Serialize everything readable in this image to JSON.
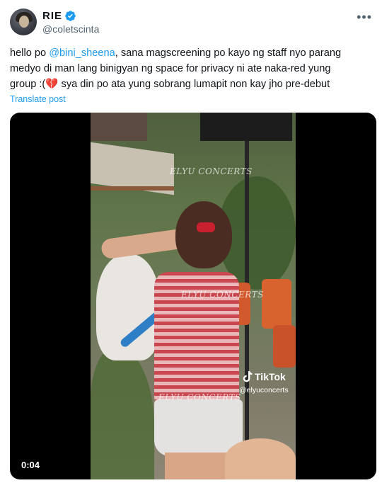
{
  "author": {
    "display_name": "RIE",
    "handle": "@coletscinta",
    "verified": true,
    "verified_color": "#1d9bf0"
  },
  "menu": {
    "more_icon": "more-horizontal-icon",
    "more_glyph": "•••"
  },
  "tweet": {
    "line1_pre": "hello po ",
    "mention": "@bini_sheena",
    "line1_post": ", sana magscreening po kayo ng staff nyo parang",
    "line2": "medyo di man lang binigyan ng space for privacy ni ate naka-red yung",
    "line3_pre": "group :(",
    "broken_heart": "💔",
    "line3_post": " sya din po ata yung sobrang lumapit non kay jho pre-debut"
  },
  "translate_label": "Translate post",
  "video": {
    "duration": "0:04",
    "watermark": "ELYU CONCERTS",
    "tiktok_label": "TikTok",
    "tiktok_handle": "@elyuconcerts"
  },
  "colors": {
    "link": "#1d9bf0",
    "text": "#0f1419",
    "secondary": "#536471",
    "media_bg": "#000000"
  }
}
